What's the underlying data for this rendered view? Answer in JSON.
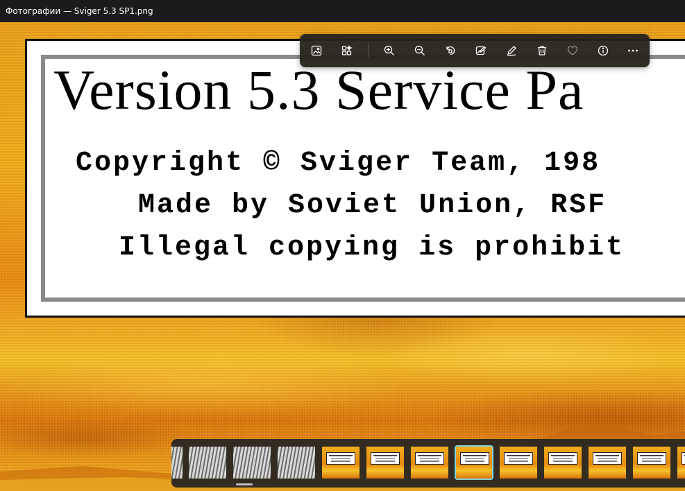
{
  "window": {
    "title": "Фотографии — Sviger 5.3 SP1.png"
  },
  "image": {
    "banner_title": "Version 5.3 Service Pa",
    "copyright_line": "Copyright © Sviger Team, 198",
    "made_line": "Made by Soviet Union, RSF",
    "illegal_line": "Illegal copying is prohibit"
  },
  "toolbar": {
    "buttons": [
      {
        "icon": "image-icon"
      },
      {
        "icon": "gallery-icon"
      },
      {
        "icon": "zoom-in-icon"
      },
      {
        "icon": "zoom-out-icon"
      },
      {
        "icon": "rotate-icon"
      },
      {
        "icon": "edit-image-icon"
      },
      {
        "icon": "draw-icon"
      },
      {
        "icon": "delete-icon"
      },
      {
        "icon": "favorite-heart-icon"
      },
      {
        "icon": "info-icon"
      },
      {
        "icon": "more-options-icon"
      }
    ]
  },
  "filmstrip": {
    "thumbnails": [
      {
        "kind": "gray",
        "selected": false
      },
      {
        "kind": "gray",
        "selected": false
      },
      {
        "kind": "gray",
        "selected": false
      },
      {
        "kind": "gray",
        "selected": false
      },
      {
        "kind": "orange",
        "selected": false
      },
      {
        "kind": "orange",
        "selected": false
      },
      {
        "kind": "orange",
        "selected": false
      },
      {
        "kind": "orange",
        "selected": true
      },
      {
        "kind": "orange",
        "selected": false
      },
      {
        "kind": "orange",
        "selected": false
      },
      {
        "kind": "orange",
        "selected": false
      },
      {
        "kind": "orange",
        "selected": false
      },
      {
        "kind": "orange",
        "selected": false
      }
    ]
  },
  "colors": {
    "titlebar_bg": "#1b1b1b",
    "toolbar_bg": "#28241e",
    "selection_accent": "#7dd3e0",
    "icon_color": "#ffffff"
  }
}
